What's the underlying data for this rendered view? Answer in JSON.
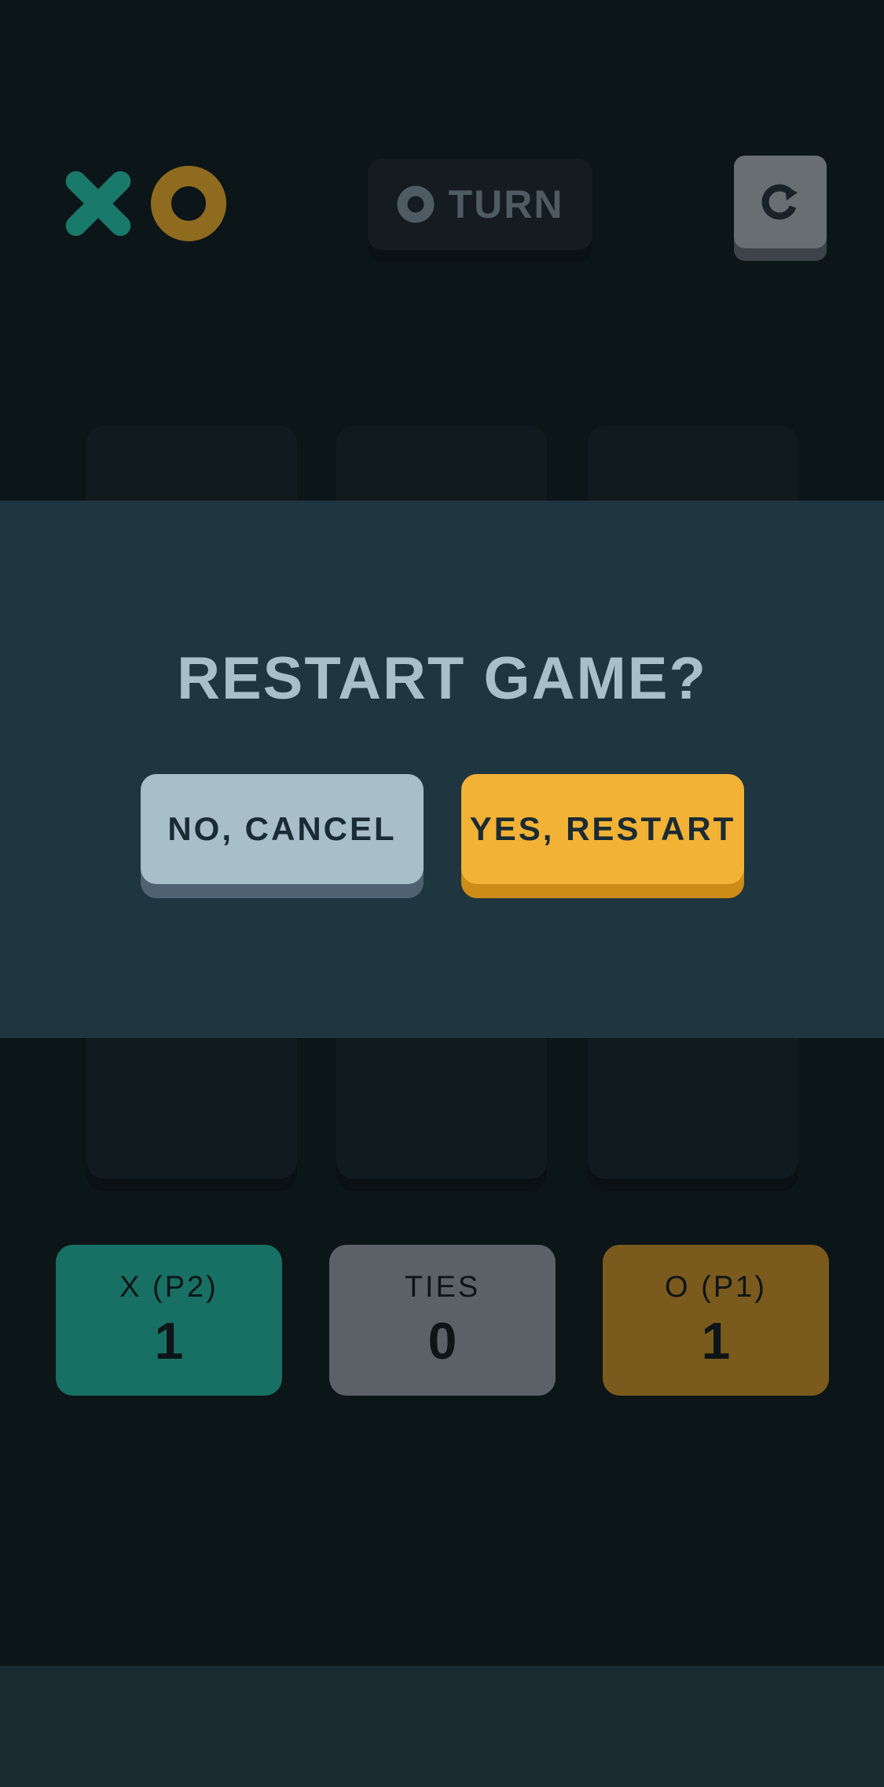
{
  "header": {
    "logo_icons": [
      "x-mark-icon",
      "o-mark-icon"
    ],
    "turn": {
      "icon": "o-mark-icon",
      "label": "TURN"
    },
    "restart_icon": "restart-icon"
  },
  "board": {
    "cells": [
      "",
      "",
      "",
      "",
      "",
      "",
      "",
      "",
      ""
    ]
  },
  "scores": [
    {
      "label": "X (P2)",
      "value": "1",
      "color": "#177063"
    },
    {
      "label": "TIES",
      "value": "0",
      "color": "#5a6267"
    },
    {
      "label": "O (P1)",
      "value": "1",
      "color": "#7a5a1d"
    }
  ],
  "modal": {
    "title": "RESTART GAME?",
    "cancel_label": "NO, CANCEL",
    "confirm_label": "YES, RESTART"
  },
  "colors": {
    "x_color": "#19796b",
    "o_color": "#8f6b1f",
    "accent_yellow": "#f2b236",
    "silver": "#a8bec9",
    "background": "#0c1518"
  }
}
